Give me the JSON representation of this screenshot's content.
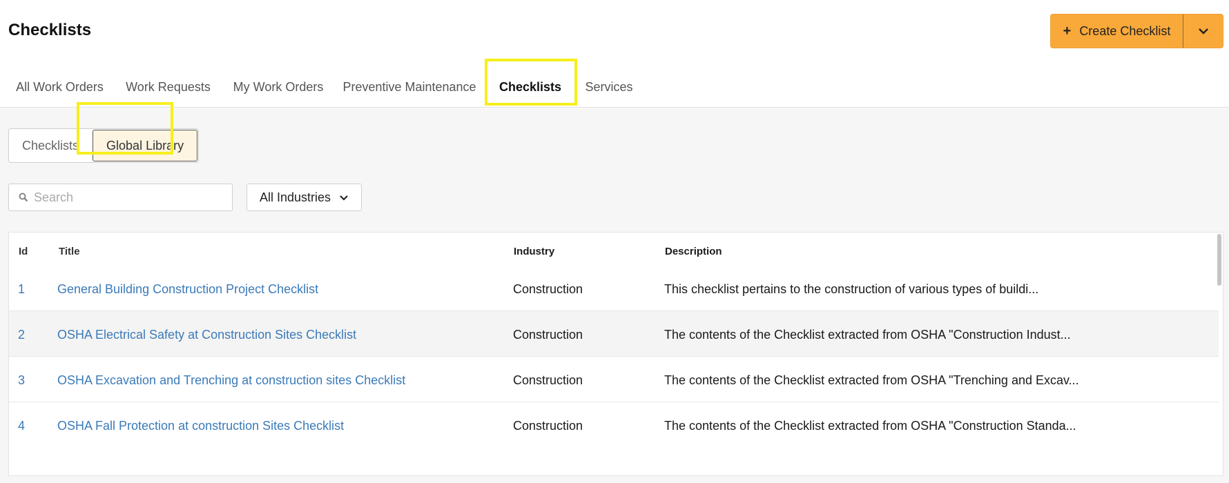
{
  "header": {
    "title": "Checklists",
    "create_button": {
      "plus": "+",
      "label": "Create Checklist"
    }
  },
  "tabs": [
    {
      "label": "All Work Orders",
      "active": false
    },
    {
      "label": "Work Requests",
      "active": false
    },
    {
      "label": "My Work Orders",
      "active": false
    },
    {
      "label": "Preventive Maintenance",
      "active": false
    },
    {
      "label": "Checklists",
      "active": true
    },
    {
      "label": "Services",
      "active": false
    }
  ],
  "segment": [
    {
      "label": "Checklists",
      "active": false
    },
    {
      "label": "Global Library",
      "active": true
    }
  ],
  "search": {
    "placeholder": "Search",
    "value": ""
  },
  "industry_filter": {
    "selected": "All Industries"
  },
  "table": {
    "columns": [
      "Id",
      "Title",
      "Industry",
      "Description"
    ],
    "rows": [
      {
        "id": "1",
        "title": "General Building Construction Project Checklist",
        "industry": "Construction",
        "description": "This checklist pertains to the construction of various types of buildi..."
      },
      {
        "id": "2",
        "title": "OSHA Electrical Safety at Construction Sites Checklist",
        "industry": "Construction",
        "description": "The contents of the Checklist extracted from OSHA \"Construction Indust..."
      },
      {
        "id": "3",
        "title": "OSHA Excavation and Trenching at construction sites Checklist",
        "industry": "Construction",
        "description": "The contents of the Checklist extracted from OSHA \"Trenching and Excav..."
      },
      {
        "id": "4",
        "title": "OSHA Fall Protection at construction Sites Checklist",
        "industry": "Construction",
        "description": "The contents of the Checklist extracted from OSHA \"Construction Standa..."
      }
    ]
  },
  "colors": {
    "accent": "#f9a93a",
    "tab_underline": "#e98533",
    "highlight": "#f6ef1e",
    "link": "#3b7ab8"
  }
}
